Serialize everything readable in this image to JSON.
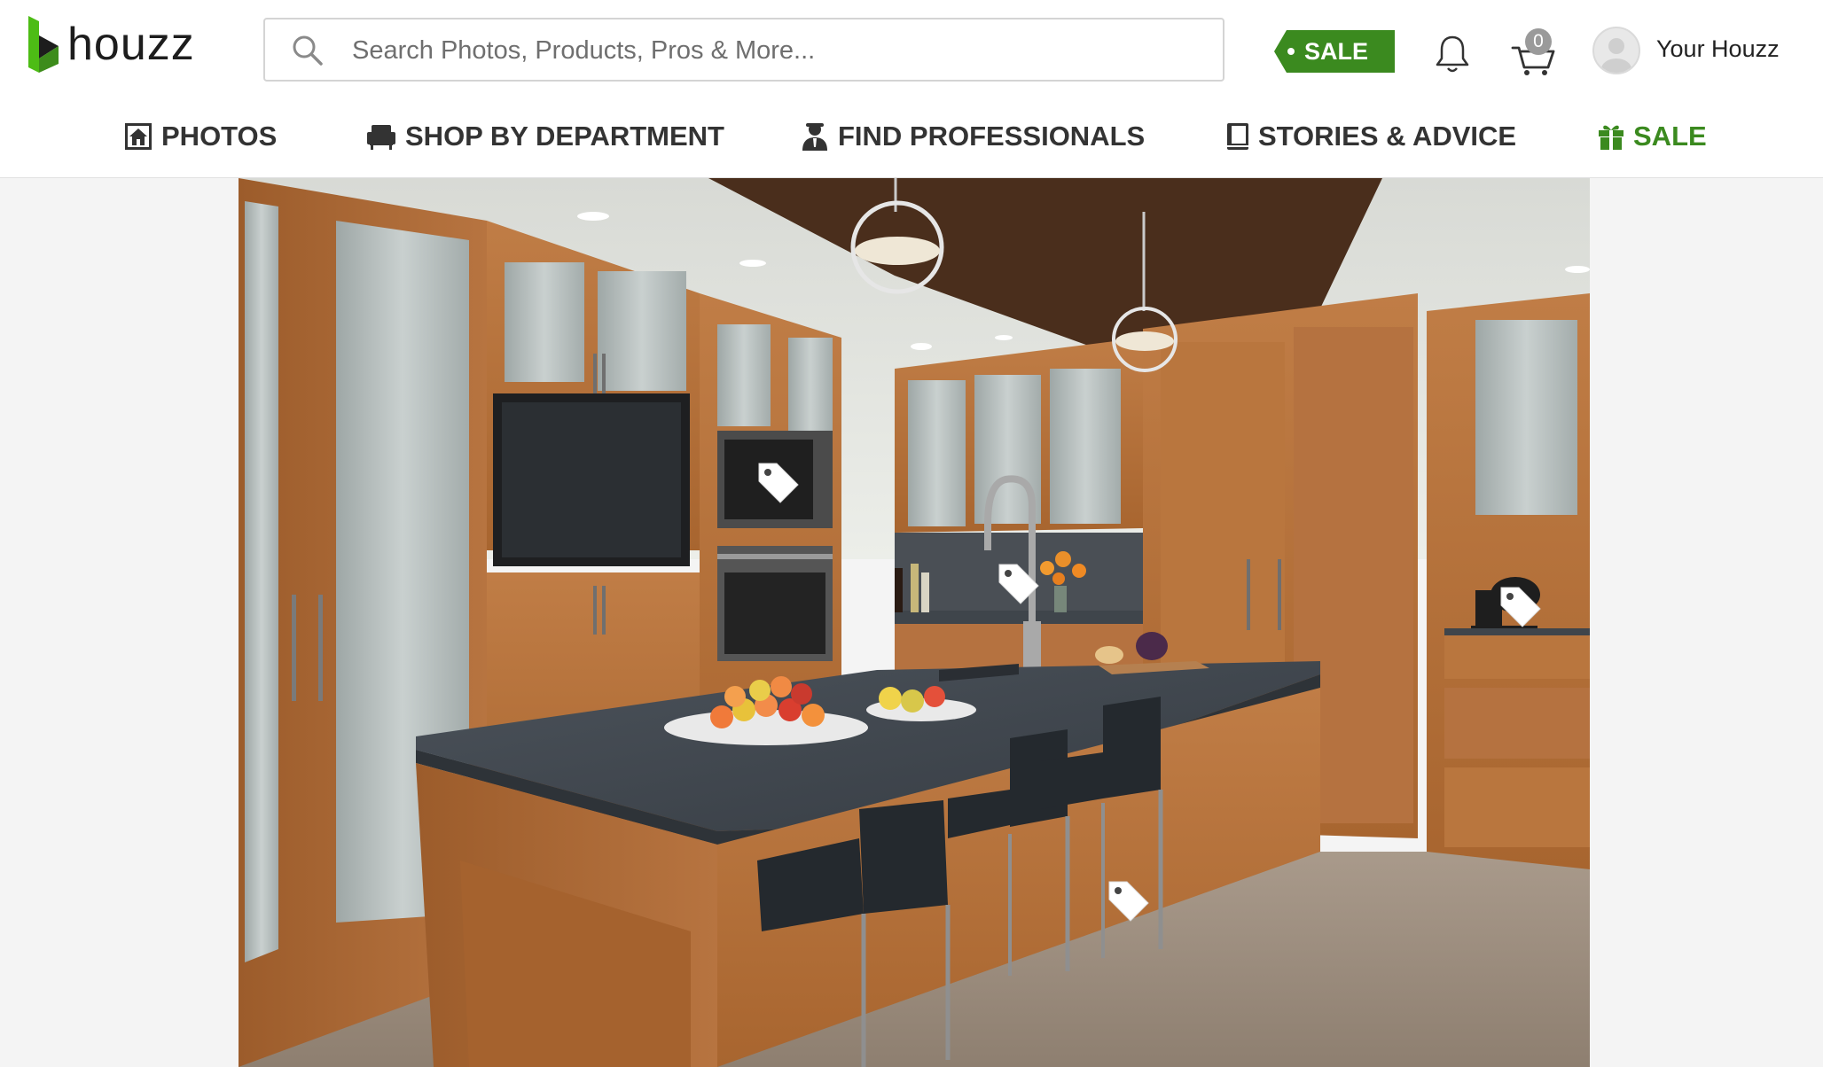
{
  "header": {
    "logo_text": "houzz",
    "search": {
      "placeholder": "Search Photos, Products, Pros & More..."
    },
    "sale_badge": "SALE",
    "cart_count": "0",
    "user_label": "Your Houzz"
  },
  "nav": {
    "items": [
      {
        "label": "PHOTOS",
        "icon": "house-photo-icon"
      },
      {
        "label": "SHOP BY DEPARTMENT",
        "icon": "armchair-icon"
      },
      {
        "label": "FIND PROFESSIONALS",
        "icon": "professional-icon"
      },
      {
        "label": "STORIES & ADVICE",
        "icon": "book-icon"
      },
      {
        "label": "SALE",
        "icon": "gift-icon"
      }
    ]
  },
  "photo": {
    "subject": "kitchen-photo",
    "product_tags": [
      "microwave",
      "faucet",
      "stand-mixer",
      "bar-stool"
    ]
  },
  "colors": {
    "brand_green": "#3b8a1f",
    "wood": "#b8733d",
    "countertop": "#3d434a"
  }
}
